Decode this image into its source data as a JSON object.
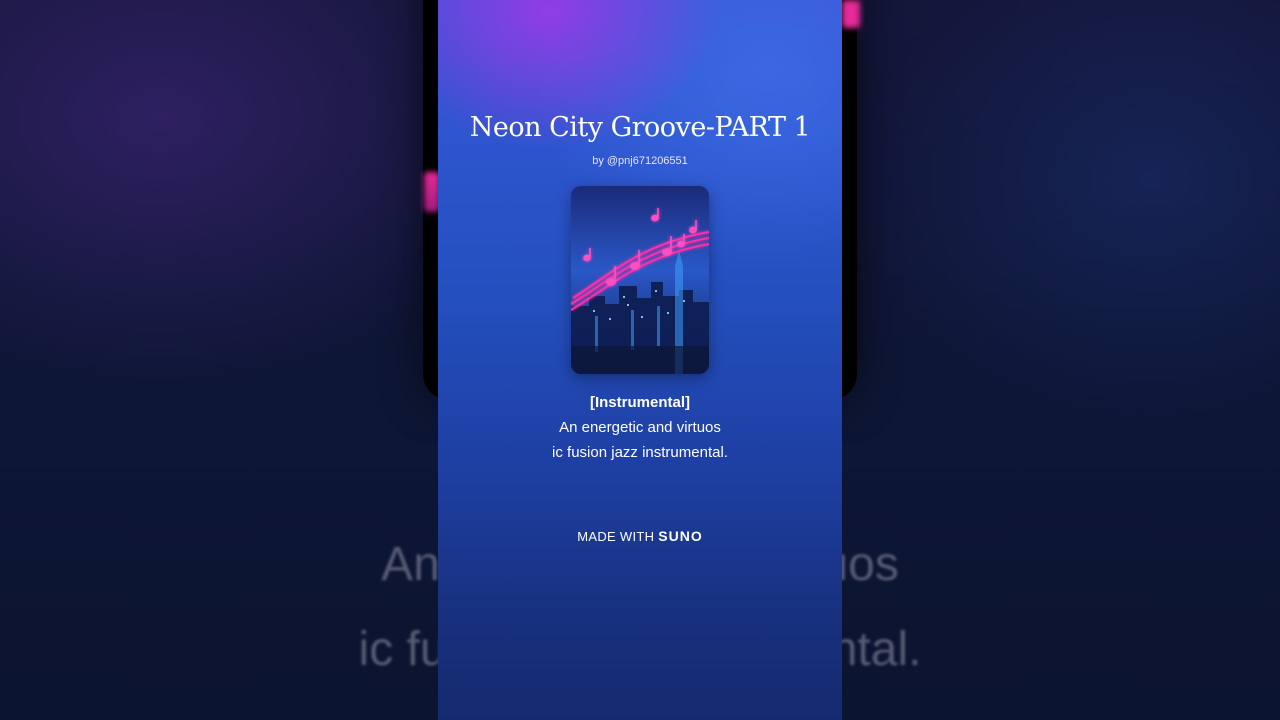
{
  "song": {
    "title": "Neon City Groove-PART 1",
    "byline": "by @pnj671206551"
  },
  "lyrics": {
    "line1": "[Instrumental]",
    "line2": "An energetic and virtuos",
    "line3": "ic fusion jazz instrumental."
  },
  "branding": {
    "made_with": "MADE WITH",
    "brand_name": "SUNO"
  },
  "background": {
    "blurred_line1": "An energetic and virtuos",
    "blurred_line2": "ic fusion jazz instrumental."
  },
  "artwork": {
    "description_icon": "neon-music-notes-city-skyline"
  },
  "colors": {
    "neon_pink": "#ff2fa8",
    "panel_top": "#3d52d6",
    "panel_bottom": "#152a6e"
  }
}
